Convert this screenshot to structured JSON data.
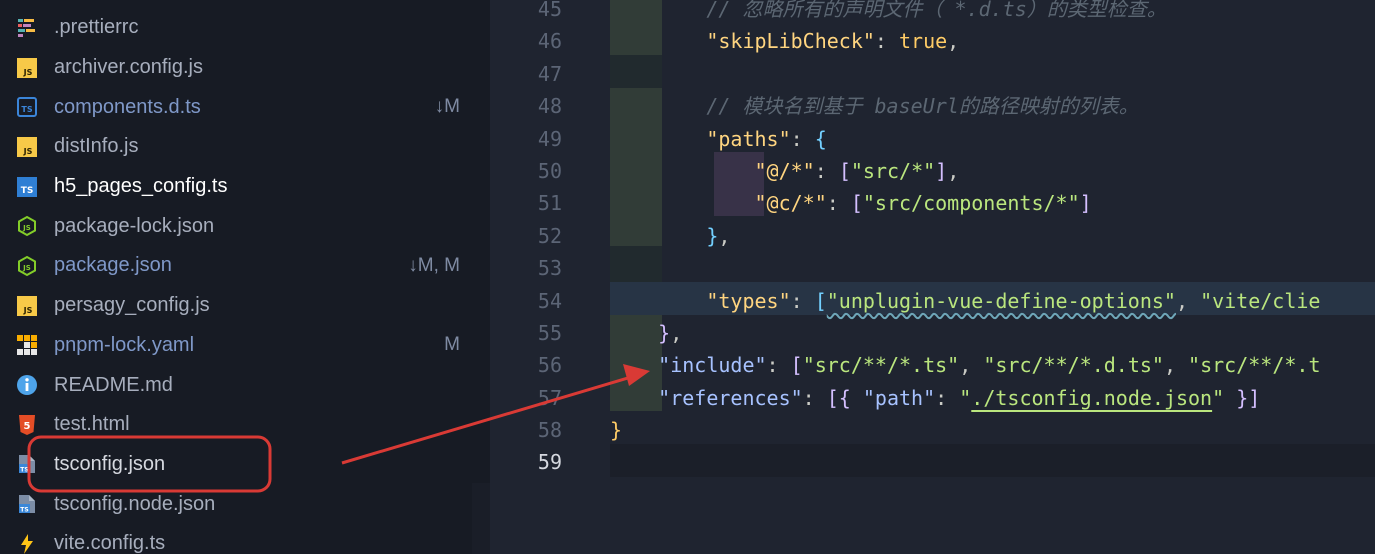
{
  "explorer": {
    "files": [
      {
        "name": ".prettierrc",
        "icon": "prettier-icon",
        "status": ""
      },
      {
        "name": "archiver.config.js",
        "icon": "js-icon",
        "status": ""
      },
      {
        "name": "components.d.ts",
        "icon": "ts-icon",
        "status": "↓M"
      },
      {
        "name": "distInfo.js",
        "icon": "js-icon",
        "status": ""
      },
      {
        "name": "h5_pages_config.ts",
        "icon": "ts-icon",
        "status": ""
      },
      {
        "name": "package-lock.json",
        "icon": "node-icon",
        "status": ""
      },
      {
        "name": "package.json",
        "icon": "node-icon",
        "status": "↓M, M"
      },
      {
        "name": "persagy_config.js",
        "icon": "js-icon",
        "status": ""
      },
      {
        "name": "pnpm-lock.yaml",
        "icon": "pnpm-icon",
        "status": "M"
      },
      {
        "name": "README.md",
        "icon": "info-icon",
        "status": ""
      },
      {
        "name": "test.html",
        "icon": "html5-icon",
        "status": ""
      },
      {
        "name": "tsconfig.json",
        "icon": "tsconfig-icon",
        "status": ""
      },
      {
        "name": "tsconfig.node.json",
        "icon": "tsconfig-icon",
        "status": ""
      },
      {
        "name": "vite.config.ts",
        "icon": "vite-icon",
        "status": ""
      }
    ]
  },
  "editor": {
    "line_numbers": [
      "45",
      "46",
      "47",
      "48",
      "49",
      "50",
      "51",
      "52",
      "53",
      "54",
      "55",
      "56",
      "57",
      "58",
      "59"
    ],
    "active_line": "59",
    "code": {
      "l45_comment": "// 忽略所有的声明文件（ *.d.ts）的类型检查。",
      "l46_key": "\"skipLibCheck\"",
      "l46_sep": ": ",
      "l46_value": "true",
      "l46_end": ",",
      "l48_comment": "// 模块名到基于 baseUrl的路径映射的列表。",
      "l49_key": "\"paths\"",
      "l49_sep": ": ",
      "l49_open": "{",
      "l50_key": "\"@/*\"",
      "l50_sep": ": ",
      "l50_open": "[",
      "l50_value": "\"src/*\"",
      "l50_close": "]",
      "l50_end": ",",
      "l51_key": "\"@c/*\"",
      "l51_sep": ": ",
      "l51_open": "[",
      "l51_value": "\"src/components/*\"",
      "l51_close": "]",
      "l52_close": "}",
      "l52_end": ",",
      "l54_key": "\"types\"",
      "l54_sep": ": ",
      "l54_open": "[",
      "l54_value1": "\"unplugin-vue-define-options\"",
      "l54_comma": ", ",
      "l54_value2": "\"vite/clie",
      "l55_close": "}",
      "l55_end": ",",
      "l56_key": "\"include\"",
      "l56_sep": ": ",
      "l56_open": "[",
      "l56_value1": "\"src/**/*.ts\"",
      "l56_comma1": ", ",
      "l56_value2": "\"src/**/*.d.ts\"",
      "l56_comma2": ", ",
      "l56_value3": "\"src/**/*.t",
      "l57_key": "\"references\"",
      "l57_sep": ": ",
      "l57_open": "[{ ",
      "l57_path_key": "\"path\"",
      "l57_path_sep": ": ",
      "l57_q1": "\"",
      "l57_path_value": "./tsconfig.node.json",
      "l57_q2": "\"",
      "l57_close": " }]",
      "l58_close": "}"
    }
  },
  "annotation": {
    "color": "#d93a35",
    "highlighted_file": "tsconfig.json"
  }
}
